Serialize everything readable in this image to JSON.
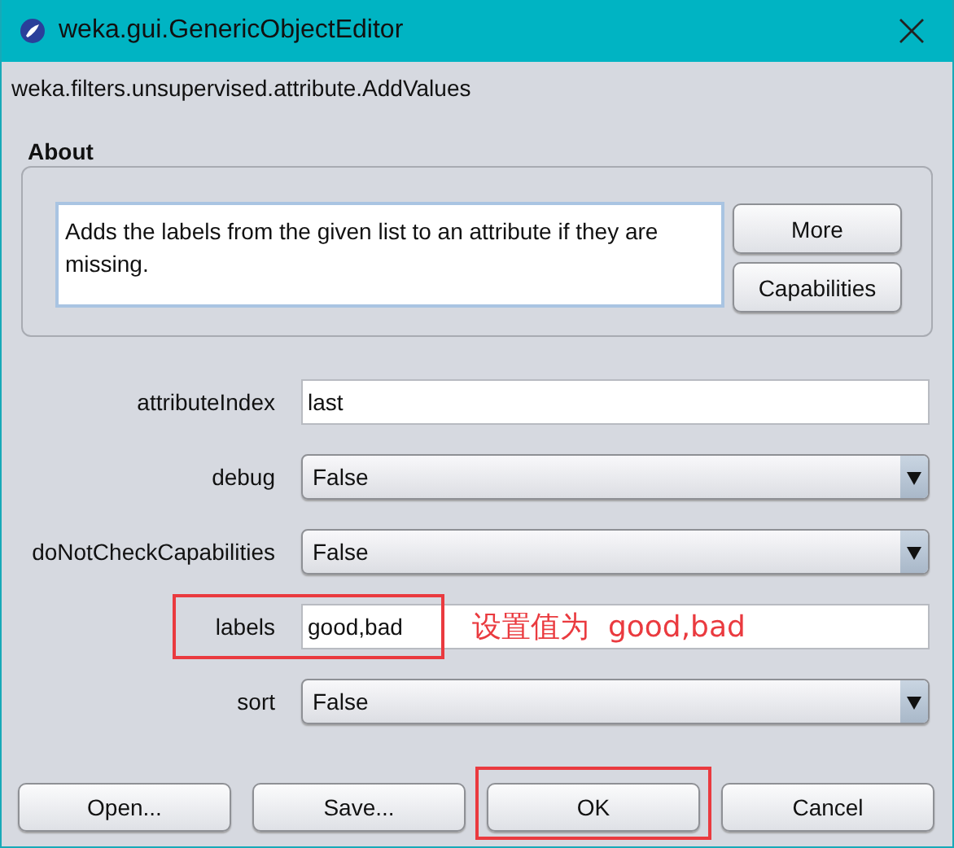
{
  "window": {
    "title": "weka.gui.GenericObjectEditor"
  },
  "class_name": "weka.filters.unsupervised.attribute.AddValues",
  "about": {
    "heading": "About",
    "text": "Adds the labels from the given list to an attribute if they are missing.",
    "buttons": [
      "More",
      "Capabilities"
    ]
  },
  "properties": [
    {
      "label": "attributeIndex",
      "kind": "text",
      "value": "last",
      "highlighted": false
    },
    {
      "label": "debug",
      "kind": "dropdown",
      "value": "False",
      "highlighted": false
    },
    {
      "label": "doNotCheckCapabilities",
      "kind": "dropdown",
      "value": "False",
      "highlighted": false
    },
    {
      "label": "labels",
      "kind": "text",
      "value": "good,bad",
      "highlighted": true,
      "note": "设置值为  good,bad"
    },
    {
      "label": "sort",
      "kind": "dropdown",
      "value": "False",
      "highlighted": false
    }
  ],
  "buttons": [
    {
      "label": "Open...",
      "highlighted": false
    },
    {
      "label": "Save...",
      "highlighted": false
    },
    {
      "label": "OK",
      "highlighted": true
    },
    {
      "label": "Cancel",
      "highlighted": false
    }
  ]
}
